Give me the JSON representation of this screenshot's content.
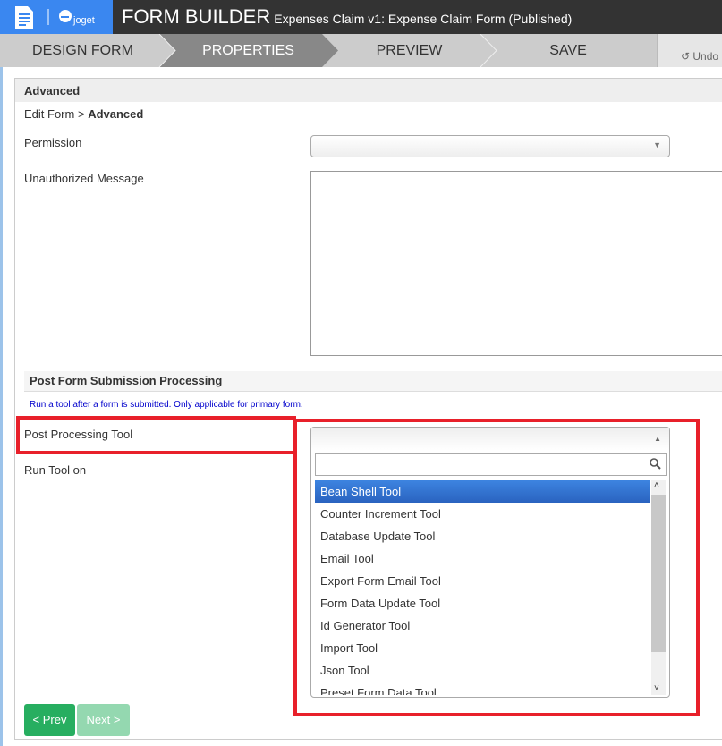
{
  "header": {
    "title": "FORM BUILDER",
    "subtitle": "Expenses Claim v1: Expense Claim Form (Published)",
    "logo_text": "joget"
  },
  "nav": {
    "tabs": [
      {
        "label": "DESIGN FORM"
      },
      {
        "label": "PROPERTIES",
        "active": true
      },
      {
        "label": "PREVIEW"
      },
      {
        "label": "SAVE"
      }
    ],
    "undo": "Undo"
  },
  "panel": {
    "title": "Advanced",
    "breadcrumb_link": "Edit Form",
    "breadcrumb_sep": ">",
    "breadcrumb_current": "Advanced"
  },
  "fields": {
    "permission_label": "Permission",
    "permission_value": "",
    "unauthorized_label": "Unauthorized Message",
    "unauthorized_value": ""
  },
  "post": {
    "section_title": "Post Form Submission Processing",
    "note": "Run a tool after a form is submitted. Only applicable for primary form.",
    "tool_label": "Post Processing Tool",
    "run_on_label": "Run Tool on",
    "search_value": "",
    "options": [
      "Bean Shell Tool",
      "Counter Increment Tool",
      "Database Update Tool",
      "Email Tool",
      "Export Form Email Tool",
      "Form Data Update Tool",
      "Id Generator Tool",
      "Import Tool",
      "Json Tool",
      "Preset Form Data Tool"
    ],
    "highlighted": "Bean Shell Tool"
  },
  "footer": {
    "prev": "< Prev",
    "next": "Next >"
  },
  "colors": {
    "header": "#333333",
    "logo": "#3a87f0",
    "highlight": "#e8202a",
    "prev": "#27ae60",
    "next": "#94d8b0"
  }
}
